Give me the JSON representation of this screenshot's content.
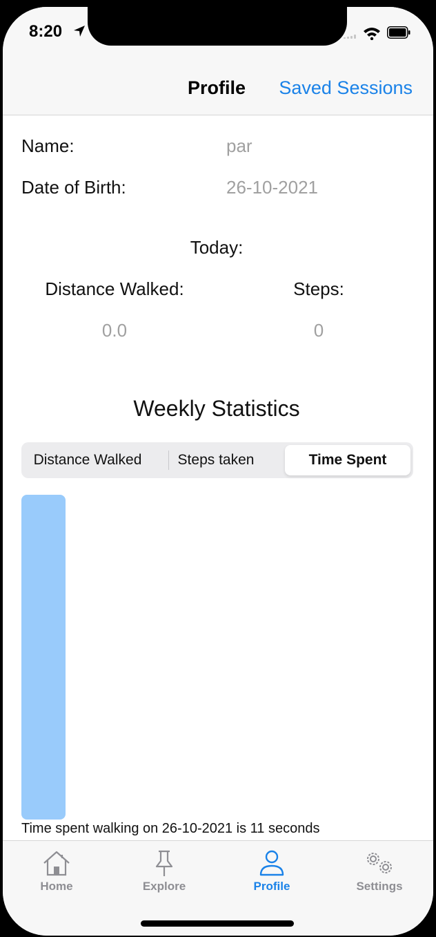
{
  "status_bar": {
    "time": "8:20"
  },
  "nav": {
    "title": "Profile",
    "right_action": "Saved Sessions"
  },
  "profile": {
    "name_label": "Name:",
    "name_value": "par",
    "dob_label": "Date of Birth:",
    "dob_value": "26-10-2021"
  },
  "today": {
    "heading": "Today:",
    "distance_label": "Distance Walked:",
    "distance_value": "0.0",
    "steps_label": "Steps:",
    "steps_value": "0"
  },
  "weekly": {
    "heading": "Weekly Statistics",
    "segments": [
      "Distance Walked",
      "Steps taken",
      "Time Spent"
    ],
    "selected_segment": "Time Spent",
    "caption": "Time spent walking on 26-10-2021 is 11 seconds"
  },
  "chart_data": {
    "type": "bar",
    "categories": [
      "26-10-2021"
    ],
    "values": [
      11
    ],
    "ylim": [
      0,
      11
    ],
    "bar_color": "#99cbfb",
    "grid": false
  },
  "tab_bar": {
    "items": [
      {
        "label": "Home",
        "icon": "house-icon"
      },
      {
        "label": "Explore",
        "icon": "pin-icon"
      },
      {
        "label": "Profile",
        "icon": "person-icon"
      },
      {
        "label": "Settings",
        "icon": "gears-icon"
      }
    ],
    "selected": "Profile",
    "active_color": "#1a82e8",
    "inactive_color": "#8e8e93"
  }
}
